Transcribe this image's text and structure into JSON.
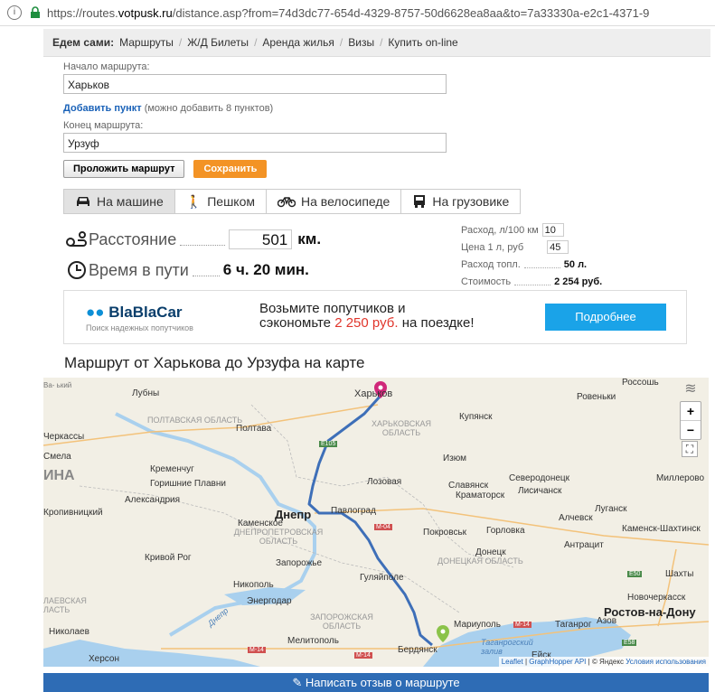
{
  "browser": {
    "url_prefix": "https://routes.",
    "url_host": "votpusk.ru",
    "url_rest": "/distance.asp?from=74d3dc77-654d-4329-8757-50d6628ea8aa&to=7a33330a-e2c1-4371-9"
  },
  "nav": {
    "lead": "Едем сами:",
    "items": [
      "Маршруты",
      "Ж/Д Билеты",
      "Аренда жилья",
      "Визы",
      "Купить on-line"
    ]
  },
  "form": {
    "start_label": "Начало маршрута:",
    "start_value": "Харьков",
    "add_link": "Добавить пункт",
    "add_note": "(можно добавить 8 пунктов)",
    "end_label": "Конец маршрута:",
    "end_value": "Урзуф",
    "build_button": "Проложить маршрут",
    "save_button": "Сохранить"
  },
  "modes": [
    {
      "label": "На машине",
      "icon": "car-icon",
      "active": true
    },
    {
      "label": "Пешком",
      "icon": "walk-icon",
      "active": false
    },
    {
      "label": "На велосипеде",
      "icon": "bicycle-icon",
      "active": false
    },
    {
      "label": "На грузовике",
      "icon": "truck-icon",
      "active": false
    }
  ],
  "stats": {
    "distance_label": "Расстояние",
    "distance_value": "501",
    "distance_unit": "км.",
    "time_label": "Время в пути",
    "time_value": "6 ч. 20 мин."
  },
  "fuel": {
    "consumption_label": "Расход, л/100 км",
    "consumption_value": "10",
    "price_label": "Цена 1 л, руб",
    "price_value": "45",
    "fuel_label": "Расход топл.",
    "fuel_value": "50 л.",
    "cost_label": "Стоимость",
    "cost_value": "2 254 руб."
  },
  "banner": {
    "brand": "BlaBlaCar",
    "tagline": "Поиск надежных попутчиков",
    "line1": "Возьмите попутчиков и",
    "line2_pre": "сэкономьте",
    "line2_price": "2 250 руб.",
    "line2_post": "на поездке!",
    "button": "Подробнее"
  },
  "map": {
    "title": "Маршрут от Харькова до Урзуфа на карте",
    "attrib_leaflet": "Leaflet",
    "attrib_gh": "GraphHopper API",
    "attrib_yandex": "© Яндекс",
    "attrib_terms": "Условия использования",
    "labels": {
      "kharkov": "Харьков",
      "lubny": "Лубны",
      "poltava_region": "ПОЛТАВСКАЯ ОБЛАСТЬ",
      "poltava": "Полтава",
      "kharkov_region": "ХАРЬКОВСКАЯ ОБЛАСТЬ",
      "kupyansk": "Купянск",
      "rovenki": "Ровеньки",
      "cherkasy": "Черкассы",
      "smela": "Смела",
      "ina": "ИНА",
      "kremenchug": "Кременчуг",
      "gorishnie": "Горишние Плавни",
      "izyum": "Изюм",
      "severodonetsk": "Северодонецк",
      "millerovo": "Миллерово",
      "aleksandria": "Александрия",
      "lozovaya": "Лозовая",
      "slavyansk": "Славянск",
      "kramatorsk": "Краматорск",
      "lisichansk": "Лисичанск",
      "kropivnitsky": "Кропивницкий",
      "dnepr": "Днепр",
      "pavlograd": "Павлоград",
      "lugansk": "Луганск",
      "alchevsk": "Алчевск",
      "kamenskoe": "Каменское",
      "dnepr_region": "ДНЕПРОПЕТРОВСКАЯ ОБЛАСТЬ",
      "pokrovsk": "Покровськ",
      "gorlovka": "Горловка",
      "kamensk": "Каменск-Шахтинск",
      "donetsk": "Донецк",
      "donetsk_region": "ДОНЕЦКАЯ ОБЛАСТЬ",
      "antratsit": "Антрацит",
      "krivoy_rog": "Кривой Рог",
      "zaporozhye": "Запорожье",
      "nikopol": "Никополь",
      "guliaipole": "Гуляйполе",
      "shakhty": "Шахты",
      "energodar": "Энергодар",
      "novocherkassk": "Новочеркасск",
      "laevskaya": "ЛАЕВСКАЯ ЛАСТЬ",
      "zaporozh_region": "ЗАПОРОЖСКАЯ ОБЛАСТЬ",
      "rostov": "Ростов-на-Дону",
      "nikolaev": "Николаев",
      "melitopol": "Мелитополь",
      "mariupol": "Мариуполь",
      "taganrog": "Таганрог",
      "azov": "Азов",
      "kherson": "Херсон",
      "berdyansk": "Бердянск",
      "taganrog_bay": "Таганрогский залив",
      "yeysk": "Ейск",
      "dnepr_river": "Днепр",
      "e105": "E105",
      "m04": "M-04",
      "m14a": "M-14",
      "m14b": "M-14",
      "m14c": "M-14",
      "e50": "E50",
      "e58": "E58",
      "rossosh": "Россошь",
      "vab": "Ва- ький"
    },
    "zoom_in": "+",
    "zoom_out": "−"
  },
  "review_button": "Написать отзыв о маршруте",
  "colors": {
    "route": "#3e6fb8",
    "accent_orange": "#f39325",
    "blablacar_button": "#1aa3e8",
    "review_bar": "#2e6cb5",
    "price_red": "#e0352b"
  }
}
